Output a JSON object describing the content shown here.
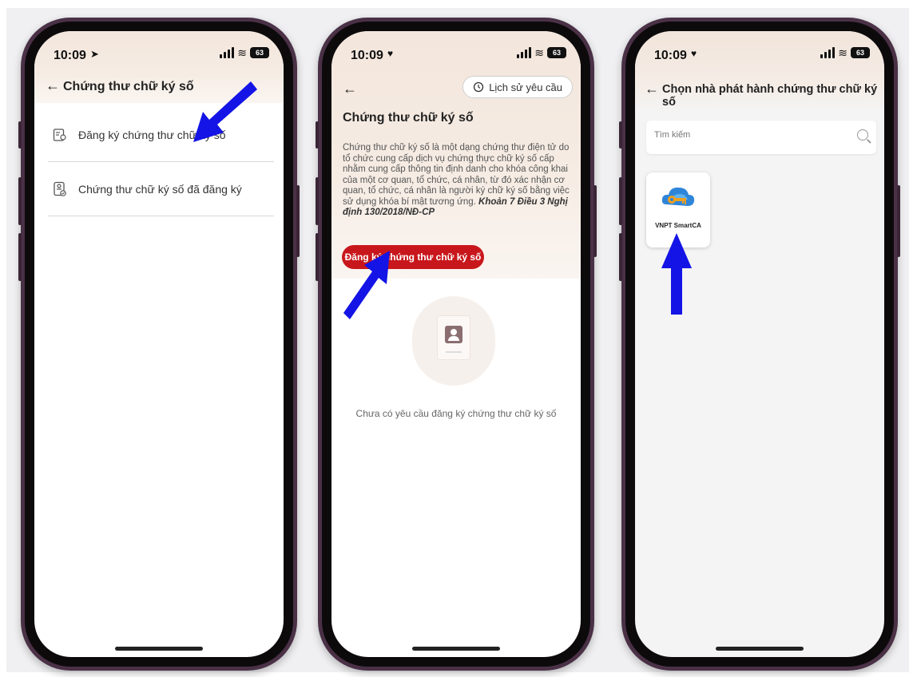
{
  "status_bar": {
    "phone1_time": "10:09",
    "phone2_time": "10:09",
    "phone3_time": "10:09",
    "battery": "63"
  },
  "screen1": {
    "title": "Chứng thư chữ ký số",
    "items": [
      {
        "label": "Đăng ký chứng thư chữ ký số",
        "icon": "certificate-list-icon"
      },
      {
        "label": "Chứng thư chữ ký số đã đăng ký",
        "icon": "registered-certificate-icon"
      }
    ]
  },
  "screen2": {
    "history_label": "Lịch sử yêu cầu",
    "title": "Chứng thư chữ ký số",
    "description": "Chứng thư chữ ký số là một dạng chứng thư điện tử do tổ chức cung cấp dịch vụ chứng thực chữ ký số cấp nhằm cung cấp thông tin định danh cho khóa công khai của một cơ quan, tổ chức, cá nhân, từ đó xác nhận cơ quan, tổ chức, cá nhân là người ký chữ ký số bằng việc sử dụng khóa bí mật tương ứng.",
    "legal_ref": "Khoản 7 Điều 3 Nghị định 130/2018/NĐ-CP",
    "register_button": "Đăng ký chứng thư chữ ký số",
    "empty_message": "Chưa có yêu cầu đăng ký chứng thư chữ ký số"
  },
  "screen3": {
    "title": "Chọn nhà phát hành chứng thư chữ ký số",
    "search_placeholder": "Tìm kiếm",
    "providers": [
      {
        "name": "VNPT SmartCA"
      }
    ]
  },
  "colors": {
    "primary_red": "#c8171c",
    "arrow_blue": "#1414e6",
    "phone_frame": "#4a3146"
  }
}
